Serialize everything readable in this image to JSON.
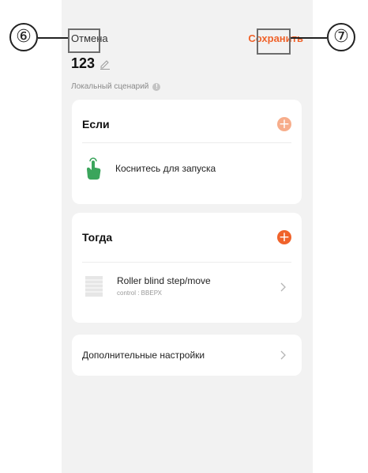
{
  "header": {
    "cancel_label": "Отмена",
    "save_label": "Сохранить"
  },
  "scenario": {
    "title": "123",
    "subtitle": "Локальный сценарий"
  },
  "if_section": {
    "heading": "Если",
    "trigger_label": "Коснитесь для запуска"
  },
  "then_section": {
    "heading": "Тогда",
    "action_title": "Roller blind step/move",
    "action_sub": "control : ВВЕРХ"
  },
  "more_settings": {
    "label": "Дополнительные настройки"
  },
  "callouts": {
    "cancel_marker": "⑥",
    "save_marker": "⑦"
  },
  "icons": {
    "edit": "pencil-icon",
    "info": "info-icon",
    "add": "plus-icon",
    "trigger": "tap-hand-icon",
    "device": "roller-blind-icon",
    "chevron": "chevron-right-icon"
  },
  "colors": {
    "accent": "#f0632b",
    "accent_light": "#f7ad8b",
    "trigger_green": "#3ba55c",
    "screen_bg": "#f2f2f2"
  }
}
